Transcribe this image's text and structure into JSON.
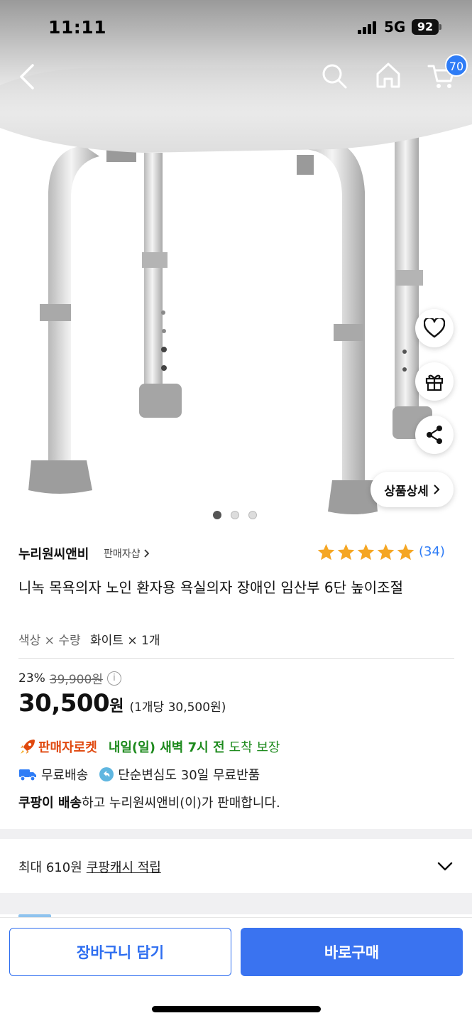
{
  "status_bar": {
    "time": "11:11",
    "network": "5G",
    "battery": "92"
  },
  "nav": {
    "cart_count": "70"
  },
  "gallery": {
    "detail_label": "상품상세",
    "total_images": 3,
    "active_index": 0
  },
  "seller": {
    "name": "누리원씨앤비",
    "shop_link": "판매자샵",
    "rating_stars": 5,
    "review_count": "(34)"
  },
  "product": {
    "title": "니녹 목욕의자 노인 환자용 욕실의자 장애인 임산부 6단 높이조절",
    "option_label": "색상 × 수량",
    "option_value": "화이트 × 1개"
  },
  "price": {
    "discount_rate": "23%",
    "original_price": "39,900원",
    "info_symbol": "i",
    "sale_price": "30,500",
    "currency": "원",
    "unit_price": "(1개당 30,500원)"
  },
  "delivery": {
    "rocket_label": "판매자로켓",
    "eta_strong": "내일(일) 새벽 7시 전",
    "eta_rest": "도착 보장",
    "free_shipping": "무료배송",
    "free_return": "단순변심도 30일 무료반품",
    "note_bold": "쿠팡이 배송",
    "note_rest": "하고 누리원씨앤비(이)가 판매합니다."
  },
  "cash": {
    "prefix": "최대 610원",
    "link": "쿠팡캐시 적립"
  },
  "actions": {
    "add_to_cart": "장바구니 담기",
    "buy_now": "바로구매"
  },
  "colors": {
    "accent_blue": "#2e6ef0",
    "rocket_orange": "#e0480e",
    "eta_green": "#1d8a1d",
    "star_gold": "#f5a623"
  }
}
